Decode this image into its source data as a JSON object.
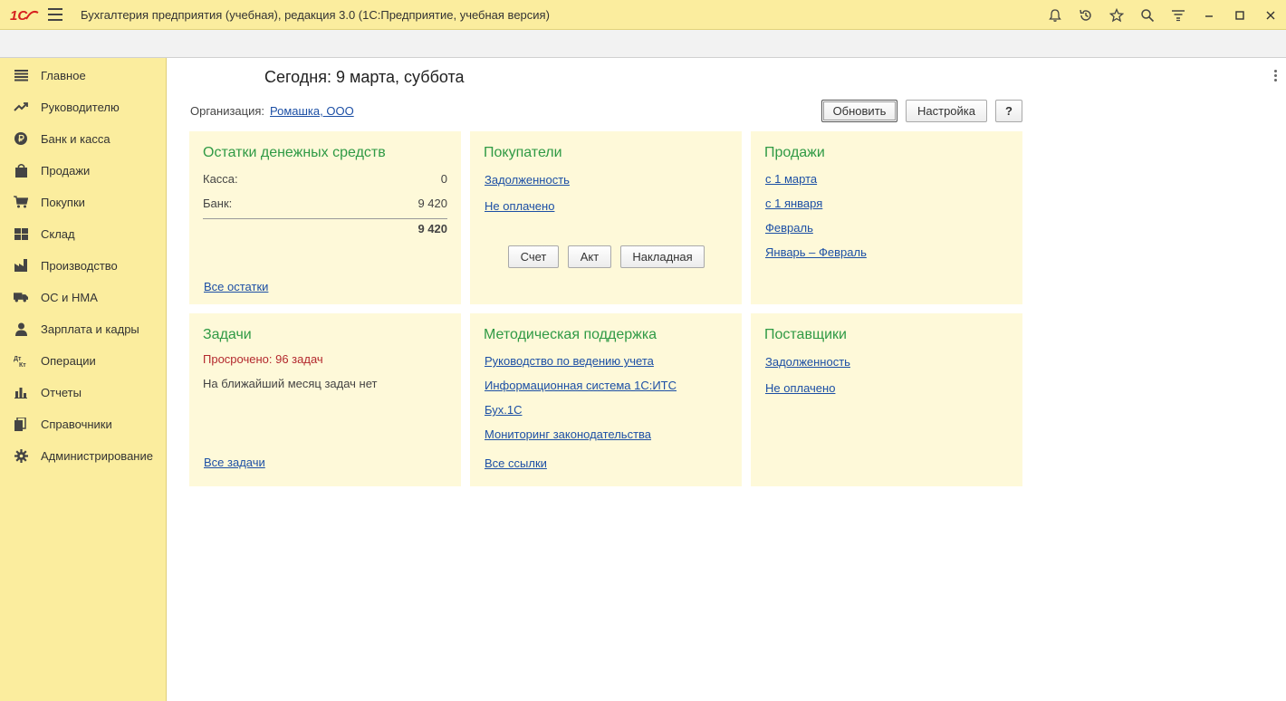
{
  "app": {
    "logo_text": "1С",
    "title": "Бухгалтерия предприятия (учебная), редакция 3.0  (1С:Предприятие, учебная версия)"
  },
  "titlebar_icons": [
    "bell-icon",
    "history-icon",
    "star-icon",
    "search-icon",
    "settings-menu-icon",
    "minimize-icon",
    "maximize-icon",
    "close-icon"
  ],
  "sidebar": {
    "items": [
      {
        "label": "Главное",
        "icon": "menu-lines-icon"
      },
      {
        "label": "Руководителю",
        "icon": "trend-icon"
      },
      {
        "label": "Банк и касса",
        "icon": "ruble-icon"
      },
      {
        "label": "Продажи",
        "icon": "bag-icon"
      },
      {
        "label": "Покупки",
        "icon": "cart-icon"
      },
      {
        "label": "Склад",
        "icon": "warehouse-icon"
      },
      {
        "label": "Производство",
        "icon": "factory-icon"
      },
      {
        "label": "ОС и НМА",
        "icon": "truck-icon"
      },
      {
        "label": "Зарплата и кадры",
        "icon": "person-icon"
      },
      {
        "label": "Операции",
        "icon": "dt-kt-icon"
      },
      {
        "label": "Отчеты",
        "icon": "bar-chart-icon"
      },
      {
        "label": "Справочники",
        "icon": "books-icon"
      },
      {
        "label": "Администрирование",
        "icon": "gear-icon"
      }
    ]
  },
  "main": {
    "today": "Сегодня: 9 марта, суббота",
    "org_label": "Организация:",
    "org_value": "Ромашка, ООО",
    "buttons": {
      "refresh": "Обновить",
      "settings": "Настройка",
      "help": "?"
    }
  },
  "panels": {
    "cash": {
      "title": "Остатки денежных средств",
      "rows": [
        {
          "label": "Касса:",
          "value": "0"
        },
        {
          "label": "Банк:",
          "value": "9 420"
        }
      ],
      "total": "9 420",
      "footer_link": "Все остатки"
    },
    "buyers": {
      "title": "Покупатели",
      "links": [
        "Задолженность",
        "Не оплачено"
      ],
      "buttons": [
        "Счет",
        "Акт",
        "Накладная"
      ]
    },
    "sales": {
      "title": "Продажи",
      "links": [
        "с 1 марта",
        "с 1 января",
        "Февраль",
        "Январь – Февраль"
      ]
    },
    "tasks": {
      "title": "Задачи",
      "overdue": "Просрочено: 96 задач",
      "note": "На ближайший месяц задач нет",
      "footer_link": "Все задачи"
    },
    "support": {
      "title": "Методическая поддержка",
      "links": [
        "Руководство по ведению учета",
        "Информационная система 1С:ИТС",
        "Бух.1С",
        "Мониторинг законодательства"
      ],
      "footer_link": "Все ссылки"
    },
    "suppliers": {
      "title": "Поставщики",
      "links": [
        "Задолженность",
        "Не оплачено"
      ]
    }
  },
  "colors": {
    "sidebar_bg": "#fbed9e",
    "panel_bg": "#fef9d9",
    "panel_title": "#2f9a45",
    "link": "#1c4fa5",
    "overdue": "#b3282d"
  }
}
